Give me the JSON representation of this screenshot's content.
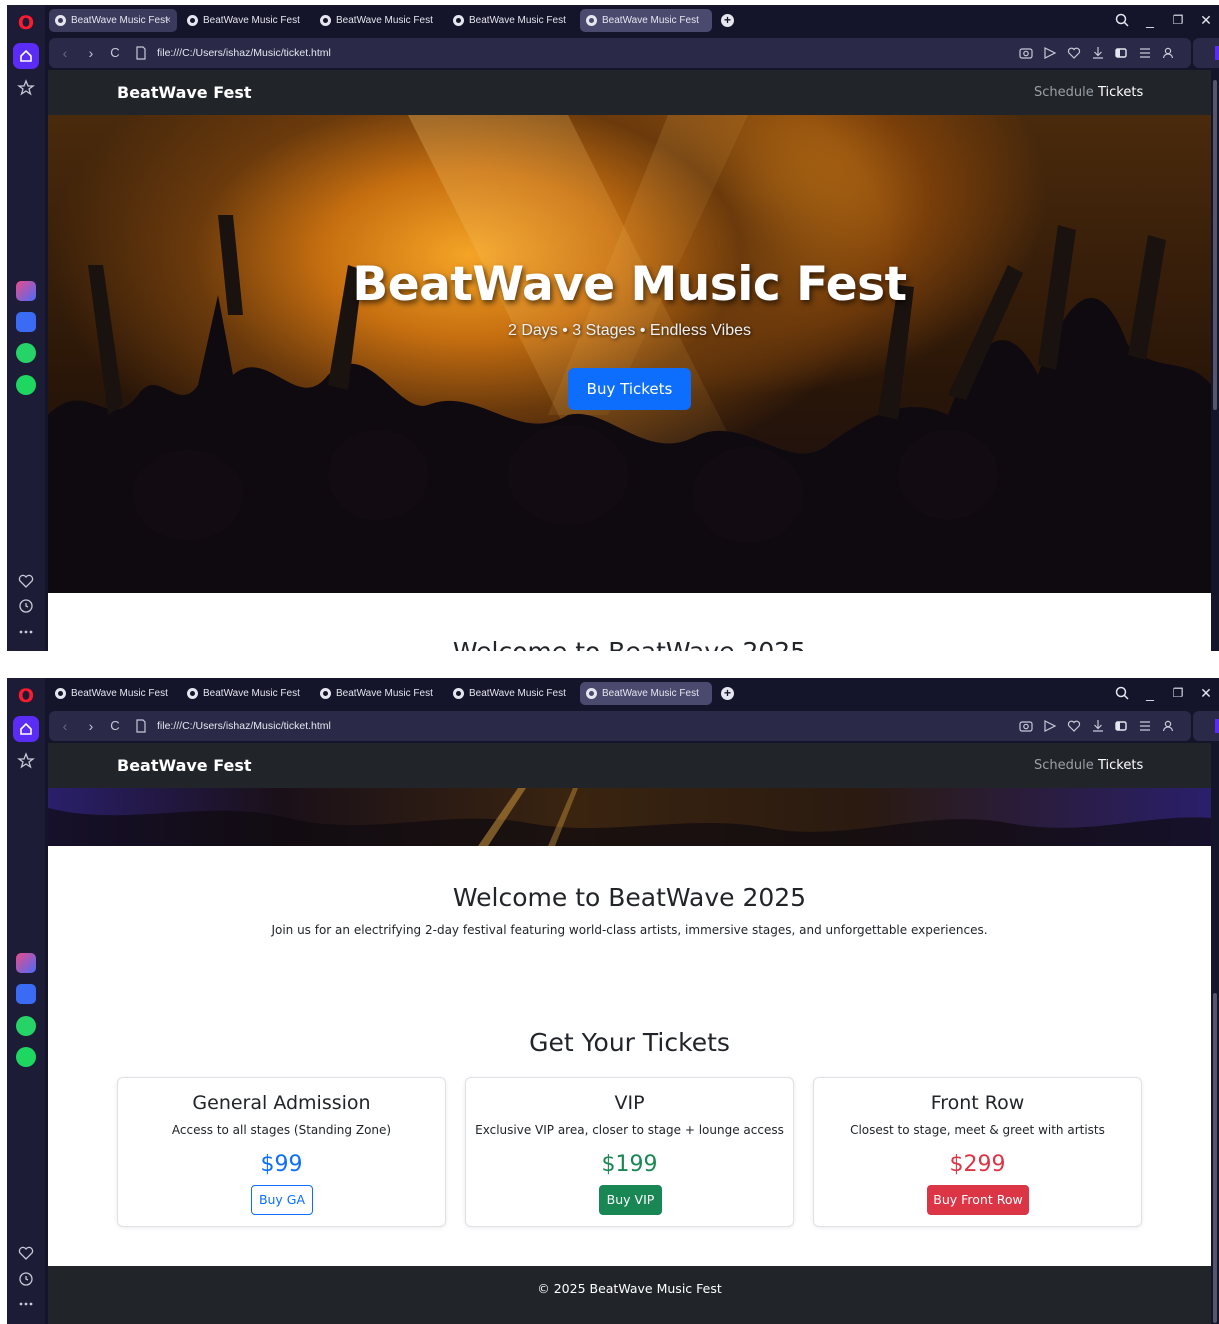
{
  "browser": {
    "tabs": [
      {
        "title": "BeatWave Music Fest"
      },
      {
        "title": "BeatWave Music Fest"
      },
      {
        "title": "BeatWave Music Fest"
      },
      {
        "title": "BeatWave Music Fest"
      },
      {
        "title": "BeatWave Music Fest"
      }
    ],
    "tab_close": "×",
    "new_tab": "+",
    "url": "file:///C:/Users/ishaz/Music/ticket.html",
    "window_controls": {
      "minimize": "_",
      "restore": "❐",
      "close": "✕"
    },
    "logo": "O"
  },
  "navbar": {
    "brand": "BeatWave Fest",
    "links": [
      {
        "label": "Schedule"
      },
      {
        "label": "Tickets"
      }
    ]
  },
  "hero": {
    "title": "BeatWave Music Fest",
    "subtitle": "2 Days • 3 Stages • Endless Vibes",
    "cta": "Buy Tickets"
  },
  "welcome": {
    "title": "Welcome to BeatWave 2025",
    "text": "Join us for an electrifying 2-day festival featuring world-class artists, immersive stages, and unforgettable experiences."
  },
  "tickets": {
    "title": "Get Your Tickets",
    "cards": [
      {
        "name": "General Admission",
        "desc": "Access to all stages (Standing Zone)",
        "price": "$99",
        "button": "Buy GA",
        "color": "#0d6efd"
      },
      {
        "name": "VIP",
        "desc": "Exclusive VIP area, closer to stage + lounge access",
        "price": "$199",
        "button": "Buy VIP",
        "color": "#198754"
      },
      {
        "name": "Front Row",
        "desc": "Closest to stage, meet & greet with artists",
        "price": "$299",
        "button": "Buy Front Row",
        "color": "#dc3545"
      }
    ]
  },
  "footer": {
    "text": "© 2025 BeatWave Music Fest"
  }
}
